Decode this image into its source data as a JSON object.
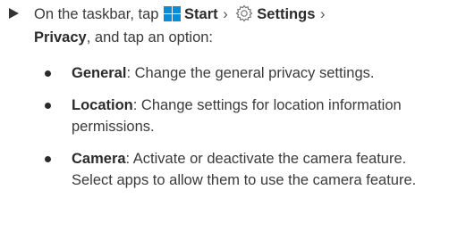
{
  "step": {
    "prefix": "On the taskbar, tap",
    "start_label": "Start",
    "separator_1": "›",
    "settings_label": "Settings",
    "separator_2": "›",
    "privacy_label": "Privacy",
    "suffix": ", and tap an option:"
  },
  "options": [
    {
      "title": "General",
      "description": ": Change the general privacy settings."
    },
    {
      "title": "Location",
      "description": ": Change settings for location information permissions."
    },
    {
      "title": "Camera",
      "description": ": Activate or deactivate the camera feature. Select apps to allow them to use the camera feature."
    }
  ],
  "icons": {
    "start": "windows-logo-icon",
    "settings": "gear-icon",
    "step_marker": "play-arrow-icon",
    "bullet": "bullet-dot"
  },
  "colors": {
    "text": "#3a3a3a",
    "bold_text": "#2b2b2b",
    "windows_logo": "#0a8cd8",
    "gear": "#777777"
  }
}
